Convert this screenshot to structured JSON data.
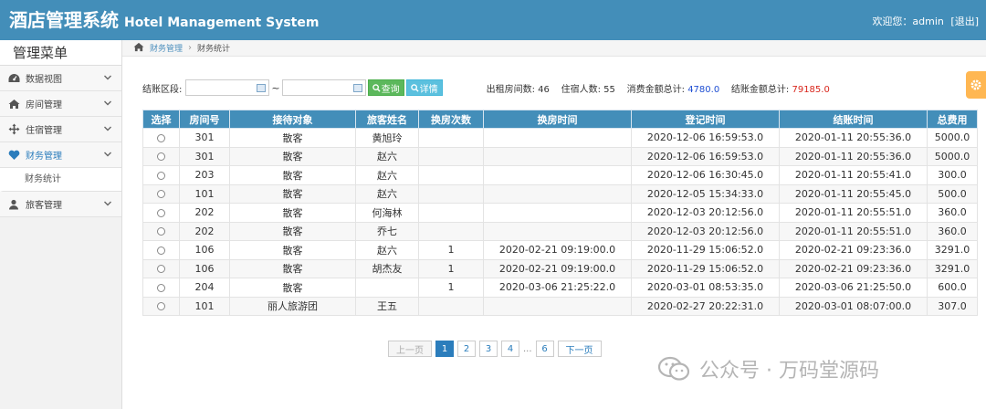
{
  "header": {
    "title_cn": "酒店管理系统",
    "title_en": "Hotel Management System",
    "welcome": "欢迎您：admin",
    "logout": "[退出]"
  },
  "sidebar": {
    "title": "管理菜单",
    "items": [
      {
        "label": "数据视图",
        "icon": "dashboard-icon"
      },
      {
        "label": "房间管理",
        "icon": "home-icon"
      },
      {
        "label": "住宿管理",
        "icon": "move-icon"
      },
      {
        "label": "财务管理",
        "icon": "heart-icon"
      },
      {
        "label": "旅客管理",
        "icon": "user-icon"
      }
    ],
    "sub_item": "财务统计"
  },
  "breadcrumb": {
    "parent": "财务管理",
    "current": "财务统计"
  },
  "filter": {
    "label": "结账区段:",
    "tilde": "~",
    "query_button": "查询",
    "detail_button": "详情",
    "stats": {
      "rented_label": "出租房间数:",
      "rented_value": "46",
      "guests_label": "住宿人数:",
      "guests_value": "55",
      "consume_label": "消费金额总计:",
      "consume_value": "4780.0",
      "checkout_label": "结账金额总计:",
      "checkout_value": "79185.0"
    }
  },
  "table": {
    "headers": [
      "选择",
      "房间号",
      "接待对象",
      "旅客姓名",
      "换房次数",
      "换房时间",
      "登记时间",
      "结账时间",
      "总费用"
    ],
    "rows": [
      [
        "301",
        "散客",
        "黄旭玲",
        "",
        "",
        "2020-12-06 16:59:53.0",
        "2020-01-11 20:55:36.0",
        "5000.0"
      ],
      [
        "301",
        "散客",
        "赵六",
        "",
        "",
        "2020-12-06 16:59:53.0",
        "2020-01-11 20:55:36.0",
        "5000.0"
      ],
      [
        "203",
        "散客",
        "赵六",
        "",
        "",
        "2020-12-06 16:30:45.0",
        "2020-01-11 20:55:41.0",
        "300.0"
      ],
      [
        "101",
        "散客",
        "赵六",
        "",
        "",
        "2020-12-05 15:34:33.0",
        "2020-01-11 20:55:45.0",
        "500.0"
      ],
      [
        "202",
        "散客",
        "何海林",
        "",
        "",
        "2020-12-03 20:12:56.0",
        "2020-01-11 20:55:51.0",
        "360.0"
      ],
      [
        "202",
        "散客",
        "乔七",
        "",
        "",
        "2020-12-03 20:12:56.0",
        "2020-01-11 20:55:51.0",
        "360.0"
      ],
      [
        "106",
        "散客",
        "赵六",
        "1",
        "2020-02-21 09:19:00.0",
        "2020-11-29 15:06:52.0",
        "2020-02-21 09:23:36.0",
        "3291.0"
      ],
      [
        "106",
        "散客",
        "胡杰友",
        "1",
        "2020-02-21 09:19:00.0",
        "2020-11-29 15:06:52.0",
        "2020-02-21 09:23:36.0",
        "3291.0"
      ],
      [
        "204",
        "散客",
        "",
        "1",
        "2020-03-06 21:25:22.0",
        "2020-03-01 08:53:35.0",
        "2020-03-06 21:25:50.0",
        "600.0"
      ],
      [
        "101",
        "丽人旅游团",
        "王五",
        "",
        "",
        "2020-02-27 20:22:31.0",
        "2020-03-01 08:07:00.0",
        "307.0"
      ]
    ]
  },
  "pagination": {
    "prev": "上一页",
    "pages": [
      "1",
      "2",
      "3",
      "4"
    ],
    "ellipsis": "...",
    "last": "6",
    "next": "下一页",
    "current": "1"
  },
  "watermark": {
    "text": "公众号 · 万码堂源码"
  },
  "colors": {
    "header_bg": "#438eb9",
    "accent": "#2b7dbc",
    "green": "#5cb85c",
    "orange": "#ffb752"
  }
}
